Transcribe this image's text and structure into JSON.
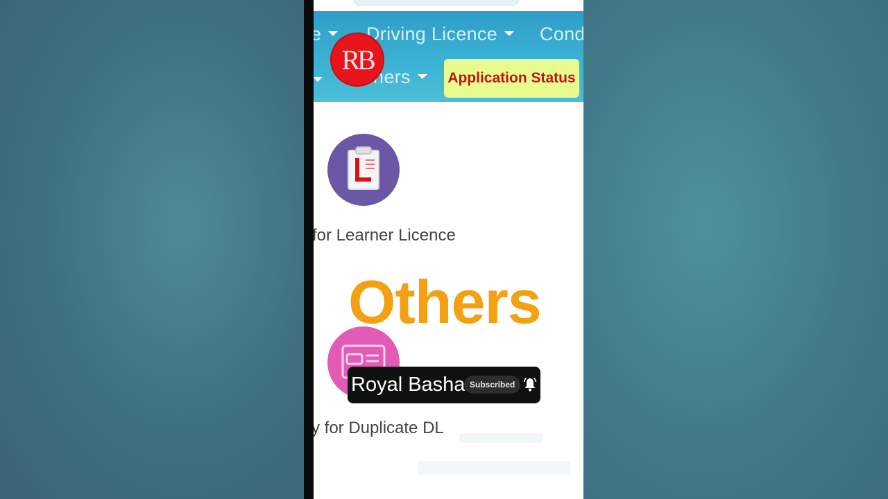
{
  "nav": {
    "row1": [
      "e",
      "Driving Licence",
      "Cond"
    ],
    "row2_partial": "hers",
    "application_status": "Application Status"
  },
  "logo": {
    "text": "RB"
  },
  "services": [
    {
      "label": "for Learner Licence",
      "icon": "learner-licence-icon"
    },
    {
      "label": "y for Duplicate DL",
      "icon": "driving-licence-card-icon"
    }
  ],
  "overlay": {
    "others_text": "Others"
  },
  "subscribe": {
    "channel_name": "Royal Basha",
    "button_label": "Subscribed",
    "icon": "bell-icon"
  },
  "colors": {
    "nav_blue": "#3bb1d3",
    "status_button_bg": "#e8fb8f",
    "status_button_text": "#c0141a",
    "others_orange": "#f3a012",
    "logo_red": "#e8141c"
  }
}
